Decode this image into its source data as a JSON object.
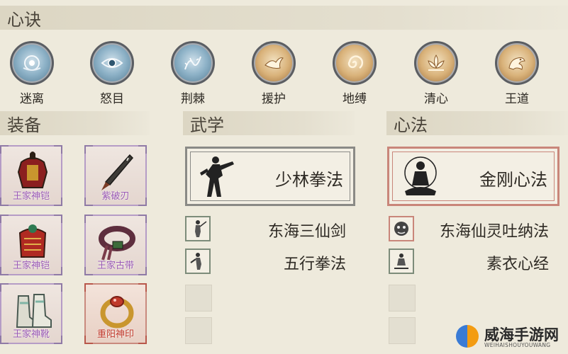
{
  "sections": {
    "xinjue": "心诀",
    "zhuangbei": "装备",
    "wuxue": "武学",
    "xinfa": "心法"
  },
  "xinjue_skills": [
    {
      "label": "迷离",
      "icon": "orb-eye-icon",
      "tone": "blue"
    },
    {
      "label": "怒目",
      "icon": "eye-icon",
      "tone": "blue"
    },
    {
      "label": "荆棘",
      "icon": "thorns-icon",
      "tone": "blue"
    },
    {
      "label": "援护",
      "icon": "bird-icon",
      "tone": "gold"
    },
    {
      "label": "地缚",
      "icon": "swirl-icon",
      "tone": "gold"
    },
    {
      "label": "清心",
      "icon": "lotus-icon",
      "tone": "gold"
    },
    {
      "label": "王道",
      "icon": "dragon-icon",
      "tone": "gold"
    }
  ],
  "equipment": [
    {
      "name": "王家神铠",
      "icon": "armor-icon",
      "rarity": "purple"
    },
    {
      "name": "紫破刃",
      "icon": "blade-icon",
      "rarity": "purple"
    },
    {
      "name": "王家神铠",
      "icon": "red-armor-icon",
      "rarity": "purple"
    },
    {
      "name": "王家古带",
      "icon": "belt-icon",
      "rarity": "purple"
    },
    {
      "name": "王家神靴",
      "icon": "boots-icon",
      "rarity": "purple"
    },
    {
      "name": "重阳神印",
      "icon": "ring-icon",
      "rarity": "red"
    }
  ],
  "wuxue": {
    "main": "少林拳法",
    "items": [
      "东海三仙剑",
      "五行拳法"
    ]
  },
  "xinfa": {
    "main": "金刚心法",
    "items": [
      "东海仙灵吐纳法",
      "素衣心经"
    ]
  },
  "watermark": {
    "name": "威海手游网",
    "site": "WEIHAISHOUYOUWANG"
  },
  "colors": {
    "background": "#eeeadc",
    "purple_rarity": "#b59cc6",
    "red_rarity": "#c9867a",
    "card_frame": "#8a8a86"
  }
}
